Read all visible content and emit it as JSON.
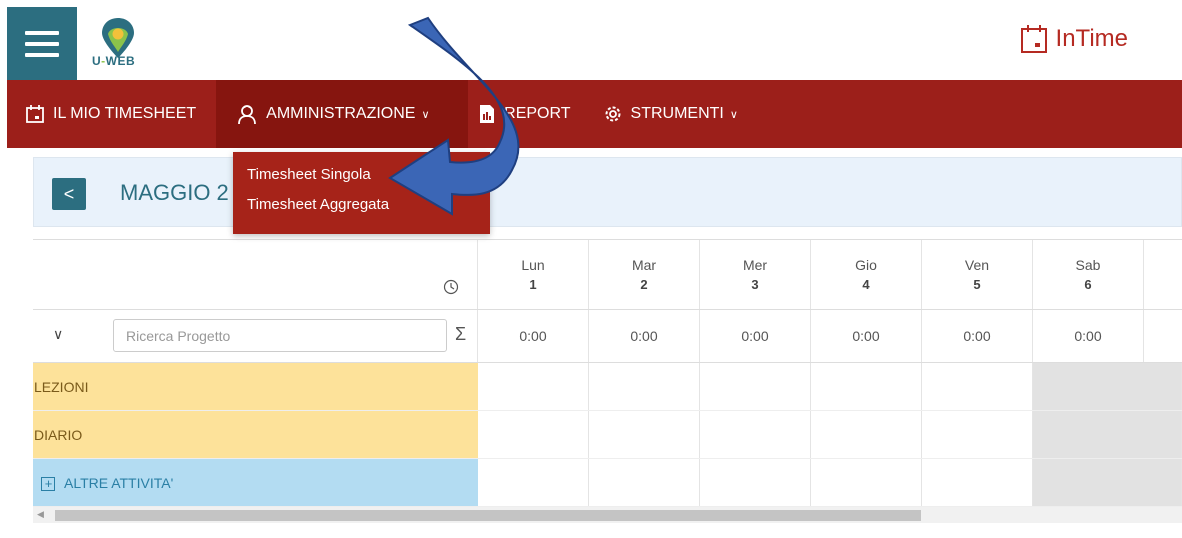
{
  "header": {
    "logo_text_a": "U",
    "logo_text_dash": "-",
    "logo_text_b": "WEB",
    "brand_name": "InTime"
  },
  "navbar": {
    "items": [
      {
        "label": "IL MIO TIMESHEET",
        "icon": "calendar-icon"
      },
      {
        "label": "AMMINISTRAZIONE",
        "icon": "user-admin-icon",
        "has_caret": true
      },
      {
        "label": "REPORT",
        "icon": "report-icon"
      },
      {
        "label": "STRUMENTI",
        "icon": "gear-icon",
        "has_caret": true
      }
    ],
    "caret": "∨"
  },
  "dropdown": {
    "items": [
      "Timesheet Singola",
      "Timesheet Aggregata"
    ]
  },
  "month": {
    "prev_label": "<",
    "title": "MAGGIO 2"
  },
  "grid": {
    "days": [
      {
        "name": "Lun",
        "num": "1",
        "weekend": false
      },
      {
        "name": "Mar",
        "num": "2",
        "weekend": false
      },
      {
        "name": "Mer",
        "num": "3",
        "weekend": false
      },
      {
        "name": "Gio",
        "num": "4",
        "weekend": false
      },
      {
        "name": "Ven",
        "num": "5",
        "weekend": false
      },
      {
        "name": "Sab",
        "num": "6",
        "weekend": true
      }
    ],
    "expand_label": "∨",
    "search_placeholder": "Ricerca Progetto",
    "sigma": "Σ",
    "totals": [
      "0:00",
      "0:00",
      "0:00",
      "0:00",
      "0:00",
      "0:00"
    ],
    "categories": [
      {
        "label": "LEZIONI",
        "color": "#fde29a"
      },
      {
        "label": "DIARIO",
        "color": "#fde29a"
      },
      {
        "label": "ALTRE ATTIVITA'",
        "color": "#b3dcf2",
        "expandable": true
      }
    ]
  },
  "colors": {
    "primary_teal": "#2c6e80",
    "nav_red": "#9c1f1a",
    "brand_red": "#b52a22",
    "arrow_blue": "#3a66b8"
  }
}
